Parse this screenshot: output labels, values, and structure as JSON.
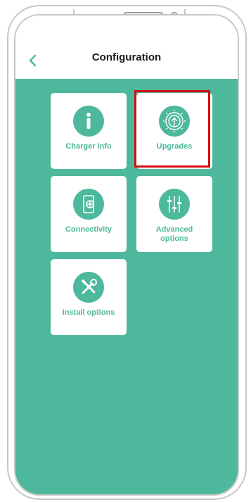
{
  "header": {
    "back_icon": "chevron-left-icon",
    "title": "Configuration"
  },
  "tiles": [
    {
      "label": "Charger info",
      "icon": "info-icon"
    },
    {
      "label": "Upgrades",
      "icon": "upgrade-gear-icon"
    },
    {
      "label": "Connectivity",
      "icon": "phone-network-icon"
    },
    {
      "label": "Advanced\noptions",
      "icon": "sliders-icon"
    },
    {
      "label": "Install options",
      "icon": "tools-icon"
    }
  ],
  "colors": {
    "accent": "#4db89b",
    "highlight": "#d40e14",
    "title": "#1b1b1b"
  }
}
